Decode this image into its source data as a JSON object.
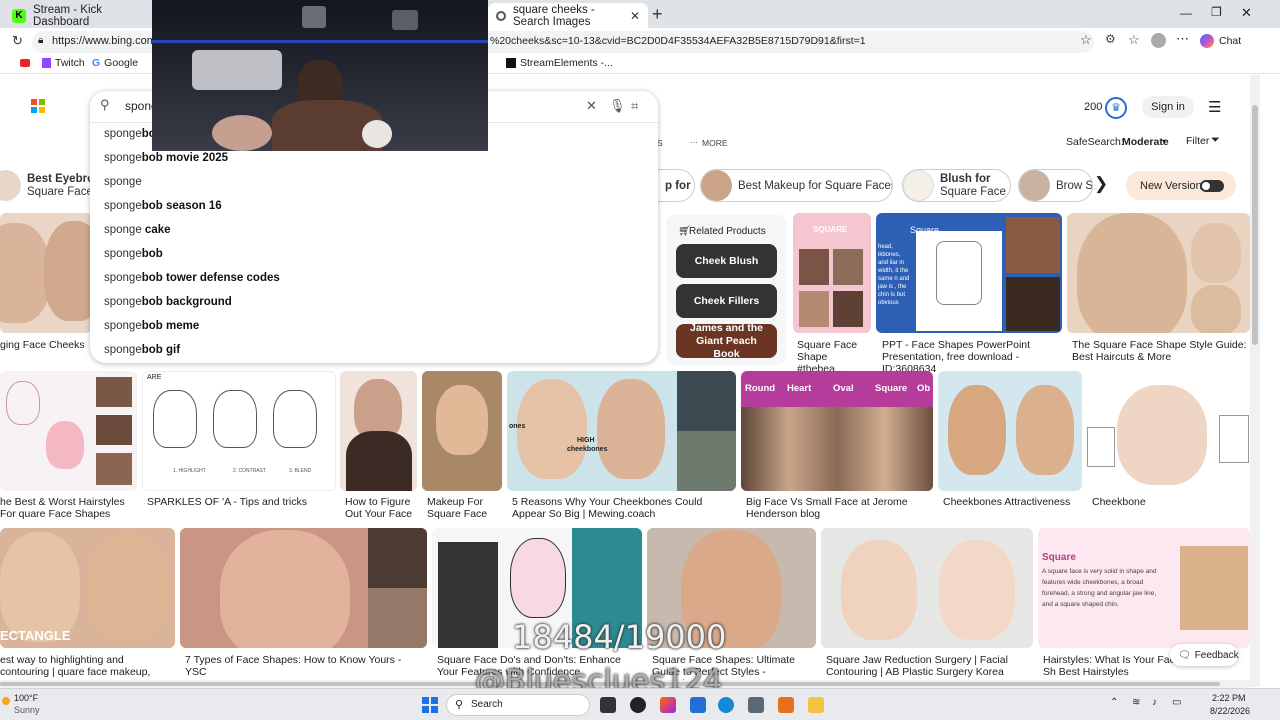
{
  "browser": {
    "tabs": [
      {
        "title": "Stream - Kick Dashboard"
      },
      {
        "title": "square cheeks - Search Images"
      }
    ],
    "url": "https://www.bing.com/i",
    "url_tail": "%20cheeks&sc=10-13&cvid=BC2D0D4F35534AEFA32B5E8715D79D91&first=1",
    "profile_label": "Chat",
    "bookmarks": [
      "Twitch",
      "Google",
      "StreamElements -..."
    ]
  },
  "bing": {
    "query": "sponge",
    "points": "200",
    "signin": "Sign in",
    "nav_more": "MORE",
    "nav_news": "S",
    "safesearch_label": "SafeSearch:",
    "safesearch_value": "Moderate",
    "filter_label": "Filter",
    "new_version": "New Version",
    "suggestions": [
      {
        "prefix": "sponge",
        "bold": "bo"
      },
      {
        "prefix": "sponge",
        "bold": "bob movie 2025"
      },
      {
        "prefix": "sponge",
        "bold": ""
      },
      {
        "prefix": "sponge",
        "bold": "bob season 16"
      },
      {
        "prefix": "sponge",
        "bold": " cake"
      },
      {
        "prefix": "sponge",
        "bold": "bob"
      },
      {
        "prefix": "sponge",
        "bold": "bob tower defense codes"
      },
      {
        "prefix": "sponge",
        "bold": "bob background"
      },
      {
        "prefix": "sponge",
        "bold": "bob meme"
      },
      {
        "prefix": "sponge",
        "bold": "bob gif"
      }
    ],
    "chips": [
      {
        "line1": "Best Eyebro",
        "line2": "Square Face"
      },
      {
        "line1": "p for",
        "line2": ""
      },
      {
        "line1": "Best Makeup for Square Faces",
        "line2": ""
      },
      {
        "line1": "Blush for",
        "line2": "Square Face"
      },
      {
        "line1": "Brow S",
        "line2": ""
      }
    ],
    "related_products": {
      "title": "Related Products",
      "items": [
        "Cheek Blush",
        "Cheek Fillers",
        "James and the Giant Peach Book"
      ]
    },
    "row1_captions": [
      "ging Face Cheeks",
      "Square Face Shape #thebea...",
      "PPT - Face Shapes PowerPoint Presentation, free download - ID:3608634",
      "The Square Face Shape Style Guide: Best Haircuts & More"
    ],
    "row1_text": {
      "square_label": "Square",
      "ppt_lines": "head, ikbones, and ilar in width, it the same n and jaw is , the chin is but obvious",
      "square_card": "SQUARE"
    },
    "row2_captions": [
      "he Best & Worst Hairstyles For quare Face Shapes",
      "SPARKLES OF 'A - Tips and tricks",
      "How to Figure Out Your Face",
      "Makeup For Square Face",
      "5 Reasons Why Your Cheekbones Could Appear So Big | Mewing.coach",
      "Big Face Vs Small Face at Jerome Henderson blog",
      "Cheekbones Attractiveness",
      "Cheekbone"
    ],
    "row2_text": {
      "faces_labels": [
        "1. HIGHLIGHT",
        "2. CONTRAST",
        "3. BLEND"
      ],
      "are": "ARE",
      "high": "HIGH",
      "cheekbones": "cheekbones",
      "ones": "ones",
      "shape_labels": [
        "Round",
        "Heart",
        "Oval",
        "Square",
        "Ob"
      ]
    },
    "row3_captions": [
      "est way to highlighting and contouring | quare face makeup, Heart ...",
      "7 Types of Face Shapes: How to Know Yours - YSC",
      "Square Face Do's and Don'ts: Enhance Your Features with Confidence",
      "Square Face Shapes: Ultimate Guide to Perfect Styles - FaceShape.io",
      "Square Jaw Reduction Surgery | Facial Contouring | AB Plastic Surgery Korea",
      "Hairstyles: What Is Your Face Sh Best Hairstyles"
    ],
    "row3_text": {
      "rectangle": "ECTANGLE",
      "square_title": "Square",
      "square_desc": "A square face is very solid in shape and features wide cheekbones, a broad forehead, a strong and angular jaw line, and a square shaped chin."
    },
    "feedback": "Feedback"
  },
  "overlay": {
    "counter": "18484/19000",
    "handle": "@Bluesclues124"
  },
  "taskbar": {
    "weather_temp": "100°F",
    "weather_desc": "Sunny",
    "search": "Search",
    "time": "2:22 PM",
    "date": "8/22/2026"
  },
  "colors": {
    "kick_green": "#53fc18",
    "bing_blue": "#1e6fd9",
    "chrome_bg": "#dfe3e8",
    "taskbar_bg": "#e8eaee"
  }
}
